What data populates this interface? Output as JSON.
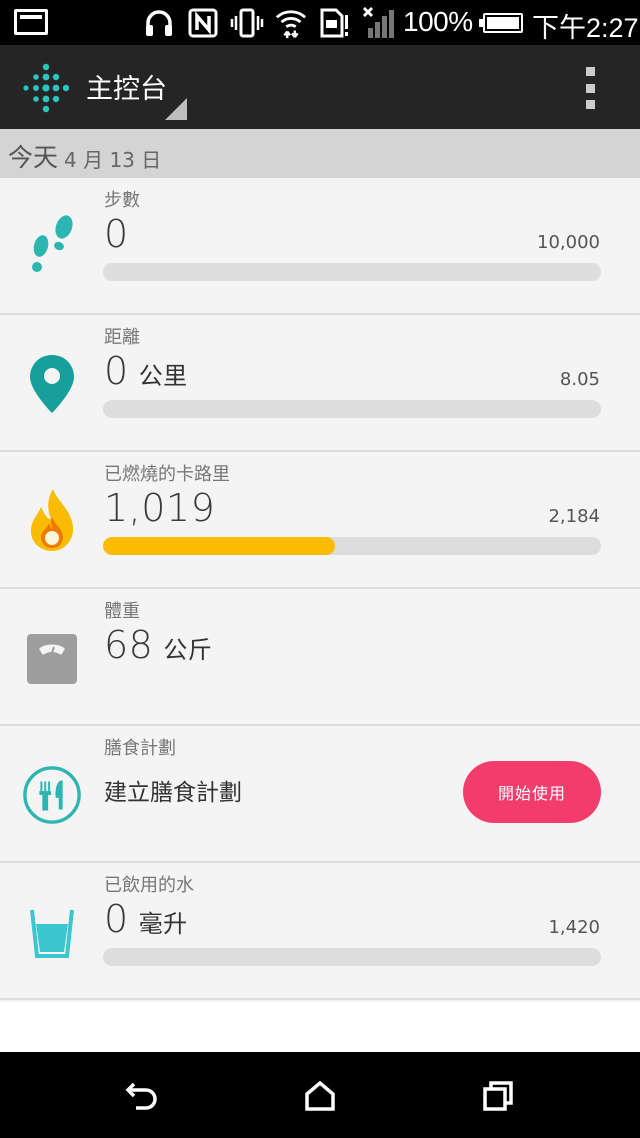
{
  "status_bar": {
    "battery_percent": "100%",
    "time": "下午2:27",
    "icons": [
      "screenshot-icon",
      "headset-icon",
      "nfc-icon",
      "vibrate-icon",
      "wifi-icon",
      "sim-alert-icon",
      "signal-icon",
      "battery-icon"
    ]
  },
  "app_bar": {
    "title": "主控台",
    "logo": "fitbit-logo",
    "menu_icon": "overflow-menu-icon"
  },
  "date_bar": {
    "today": "今天",
    "date": "4 月 13 日"
  },
  "tiles": [
    {
      "id": "steps",
      "label": "步數",
      "value": "0",
      "unit": "",
      "goal": "10,000",
      "progress": 0,
      "icon": "footprints-icon",
      "color": "#2cb6b2"
    },
    {
      "id": "distance",
      "label": "距離",
      "value": "0",
      "unit": "公里",
      "goal": "8.05",
      "progress": 0,
      "icon": "map-pin-icon",
      "color": "#169f9b"
    },
    {
      "id": "calories",
      "label": "已燃燒的卡路里",
      "value": "1,019",
      "unit": "",
      "goal": "2,184",
      "progress": 0.466,
      "icon": "flame-icon",
      "color": "#fabb00"
    },
    {
      "id": "weight",
      "label": "體重",
      "value": "68",
      "unit": "公斤",
      "icon": "scale-icon",
      "color": "#9e9e9e"
    },
    {
      "id": "food",
      "label": "膳食計劃",
      "cta": "建立膳食計劃",
      "button": "開始使用",
      "icon": "fork-knife-icon",
      "color": "#2cb6b2",
      "button_color": "#f23d6c"
    },
    {
      "id": "water",
      "label": "已飲用的水",
      "value": "0",
      "unit": "毫升",
      "goal": "1,420",
      "progress": 0,
      "icon": "glass-icon",
      "color": "#3cc7d0"
    }
  ],
  "nav_bar": {
    "icons": [
      "back-icon",
      "home-icon",
      "recent-apps-icon"
    ]
  }
}
